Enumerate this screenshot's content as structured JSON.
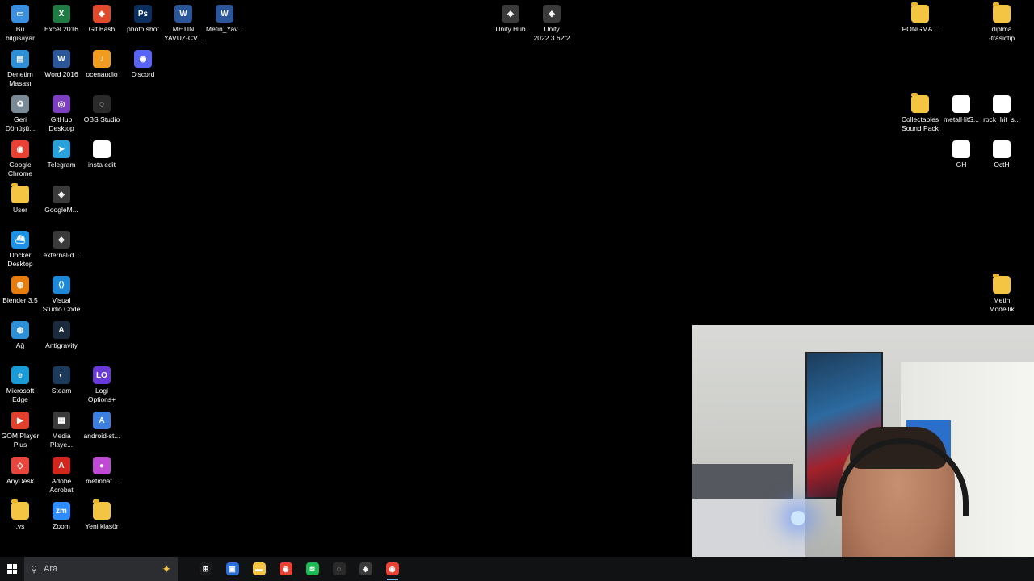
{
  "desktop": {
    "icons": [
      {
        "label": "Bu\nbilgisayar",
        "icon": "computer-icon",
        "color": "#3b8fe0",
        "glyph": "▭"
      },
      {
        "label": "Excel 2016",
        "icon": "excel-icon",
        "color": "#1f7a44",
        "glyph": "X"
      },
      {
        "label": "Git Bash",
        "icon": "git-bash-icon",
        "color": "#e24a2c",
        "glyph": "◆"
      },
      {
        "label": "photo shot",
        "icon": "photoshop-icon",
        "color": "#0b2f5f",
        "glyph": "Ps"
      },
      {
        "label": "METIN\nYAVUZ-CV...",
        "icon": "word-doc-icon",
        "color": "#2b579a",
        "glyph": "W"
      },
      {
        "label": "Metin_Yav...",
        "icon": "word-doc-icon",
        "color": "#2b579a",
        "glyph": "W"
      },
      {
        "label": "Unity Hub",
        "icon": "unity-hub-icon",
        "color": "#3a3a3a",
        "glyph": "◈"
      },
      {
        "label": "Unity\n2022.3.62f2",
        "icon": "unity-icon",
        "color": "#3a3a3a",
        "glyph": "◈"
      },
      {
        "label": "PONGMA...",
        "icon": "folder-icon",
        "color": "#f4c542",
        "glyph": ""
      },
      {
        "label": "diplma\n-trasictip",
        "icon": "folder-icon",
        "color": "#f4c542",
        "glyph": ""
      },
      {
        "label": "Denetim\nMasası",
        "icon": "control-panel-icon",
        "color": "#2d8fd6",
        "glyph": "▤"
      },
      {
        "label": "Word 2016",
        "icon": "word-icon",
        "color": "#2b579a",
        "glyph": "W"
      },
      {
        "label": "ocenaudio",
        "icon": "ocenaudio-icon",
        "color": "#f29c1f",
        "glyph": "♪"
      },
      {
        "label": "Discord",
        "icon": "discord-icon",
        "color": "#5865f2",
        "glyph": "◉"
      },
      {
        "label": "Geri\nDönüşü...",
        "icon": "recycle-bin-icon",
        "color": "#7a8a96",
        "glyph": "♻"
      },
      {
        "label": "GitHub\nDesktop",
        "icon": "github-desktop-icon",
        "color": "#7b3fbf",
        "glyph": "◎"
      },
      {
        "label": "OBS Studio",
        "icon": "obs-icon",
        "color": "#2a2a2a",
        "glyph": "◌"
      },
      {
        "label": "Collectables\nSound Pack",
        "icon": "folder-icon",
        "color": "#f4c542",
        "glyph": ""
      },
      {
        "label": "metalHitS...",
        "icon": "audio-file-icon",
        "color": "#ffffff",
        "glyph": "▶"
      },
      {
        "label": "rock_hit_s...",
        "icon": "audio-file-icon",
        "color": "#ffffff",
        "glyph": "▶"
      },
      {
        "label": "Google\nChrome",
        "icon": "chrome-icon",
        "color": "#e94235",
        "glyph": "◉"
      },
      {
        "label": "Telegram",
        "icon": "telegram-icon",
        "color": "#2aa1da",
        "glyph": "➤"
      },
      {
        "label": "insta edit",
        "icon": "video-file-icon",
        "color": "#ffffff",
        "glyph": "▶"
      },
      {
        "label": "GH",
        "icon": "audio-file-icon",
        "color": "#ffffff",
        "glyph": "▶"
      },
      {
        "label": "OctH",
        "icon": "audio-file-icon",
        "color": "#ffffff",
        "glyph": "▶"
      },
      {
        "label": "User",
        "icon": "user-folder-icon",
        "color": "#f4c542",
        "glyph": "☺"
      },
      {
        "label": "GoogleM...",
        "icon": "unity-shortcut-icon",
        "color": "#3a3a3a",
        "glyph": "◈"
      },
      {
        "label": "Docker\nDesktop",
        "icon": "docker-icon",
        "color": "#1d91e6",
        "glyph": "⛴"
      },
      {
        "label": "external-d...",
        "icon": "unity-shortcut-icon",
        "color": "#3a3a3a",
        "glyph": "◈"
      },
      {
        "label": "Blender 3.5",
        "icon": "blender-icon",
        "color": "#e87d0d",
        "glyph": "◍"
      },
      {
        "label": "Visual\nStudio Code",
        "icon": "vscode-icon",
        "color": "#1e88d6",
        "glyph": "⟨⟩"
      },
      {
        "label": "Metin\nModellik",
        "icon": "folder-icon",
        "color": "#f4c542",
        "glyph": ""
      },
      {
        "label": "Ağ",
        "icon": "network-icon",
        "color": "#2d8fd6",
        "glyph": "◍"
      },
      {
        "label": "Antigravity",
        "icon": "antigravity-icon",
        "color": "#1b2a3a",
        "glyph": "A"
      },
      {
        "label": "Microsoft\nEdge",
        "icon": "edge-icon",
        "color": "#1a9ad6",
        "glyph": "e"
      },
      {
        "label": "Steam",
        "icon": "steam-icon",
        "color": "#1b3a5c",
        "glyph": "◐"
      },
      {
        "label": "Logi\nOptions+",
        "icon": "logi-icon",
        "color": "#6a3ad6",
        "glyph": "LO"
      },
      {
        "label": "GOM Player\nPlus",
        "icon": "gom-player-icon",
        "color": "#e0402c",
        "glyph": "▶"
      },
      {
        "label": "Media\nPlaye...",
        "icon": "media-player-icon",
        "color": "#3a3a3a",
        "glyph": "▦"
      },
      {
        "label": "android-st...",
        "icon": "android-studio-icon",
        "color": "#3d7fe0",
        "glyph": "A"
      },
      {
        "label": "AnyDesk",
        "icon": "anydesk-icon",
        "color": "#e8453c",
        "glyph": "◇"
      },
      {
        "label": "Adobe\nAcrobat",
        "icon": "acrobat-icon",
        "color": "#d2261c",
        "glyph": "A"
      },
      {
        "label": "metinbat...",
        "icon": "drop-icon",
        "color": "#c04ad6",
        "glyph": "●"
      },
      {
        "label": ".vs",
        "icon": "folder-icon",
        "color": "#f4c542",
        "glyph": ""
      },
      {
        "label": "Zoom",
        "icon": "zoom-icon",
        "color": "#2d8cff",
        "glyph": "zm"
      },
      {
        "label": "Yeni klasör",
        "icon": "folder-icon",
        "color": "#f4c542",
        "glyph": ""
      }
    ]
  },
  "taskbar": {
    "search_placeholder": "Ara",
    "items": [
      {
        "icon": "task-view-icon",
        "color": "#1a1a1a",
        "glyph": "⊞"
      },
      {
        "icon": "store-icon",
        "color": "#2d6fd6",
        "glyph": "▣"
      },
      {
        "icon": "file-explorer-icon",
        "color": "#f4c542",
        "glyph": "▬"
      },
      {
        "icon": "chrome-icon",
        "color": "#e94235",
        "glyph": "◉"
      },
      {
        "icon": "spotify-icon",
        "color": "#1db954",
        "glyph": "≋"
      },
      {
        "icon": "obs-icon",
        "color": "#2a2a2a",
        "glyph": "◌"
      },
      {
        "icon": "unity-icon",
        "color": "#3a3a3a",
        "glyph": "◈"
      },
      {
        "icon": "chrome-icon",
        "color": "#e94235",
        "glyph": "◉",
        "active": true
      }
    ]
  }
}
